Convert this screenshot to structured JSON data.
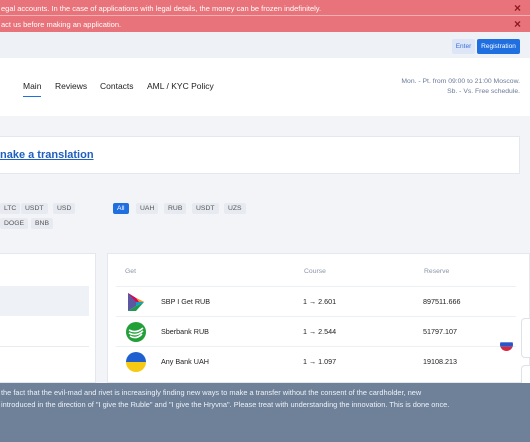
{
  "alerts": [
    {
      "text": "egal accounts. In the case of applications with legal details, the money can be frozen indefinitely.",
      "close": "×"
    },
    {
      "text": "act us before making an application.",
      "close": "×"
    }
  ],
  "topbar": {
    "enter_label": "Enter",
    "register_label": "Registration"
  },
  "nav": {
    "items": [
      {
        "label": "Main",
        "active": true
      },
      {
        "label": "Reviews",
        "active": false
      },
      {
        "label": "Contacts",
        "active": false
      },
      {
        "label": "AML / KYC Policy",
        "active": false
      }
    ],
    "schedule_line1": "Mon. - Pt. from 09:00 to 21:00 Moscow.",
    "schedule_line2": "Sb. - Vs. Free schedule."
  },
  "translate": {
    "link_text": "nake a translation"
  },
  "give_filters": [
    "LTC",
    "USDT",
    "USD",
    "DOGE",
    "BNB"
  ],
  "get_filters": [
    {
      "label": "All",
      "active": true
    },
    {
      "label": "UAH",
      "active": false
    },
    {
      "label": "RUB",
      "active": false
    },
    {
      "label": "USDT",
      "active": false
    },
    {
      "label": "UZS",
      "active": false
    }
  ],
  "table": {
    "headers": {
      "get": "Get",
      "course": "Course",
      "reserve": "Reserve"
    },
    "rows": [
      {
        "name": "SBP I Get RUB",
        "course": "1 → 2.601",
        "reserve": "897511.666",
        "icon": "sbp-icon"
      },
      {
        "name": "Sberbank RUB",
        "course": "1 → 2.544",
        "reserve": "51797.107",
        "icon": "sberbank-icon"
      },
      {
        "name": "Any Bank UAH",
        "course": "1 → 1.097",
        "reserve": "19108.213",
        "icon": "ukraine-flag-icon"
      }
    ]
  },
  "notice": {
    "line1": "the fact that the evil-mad and rivet is increasingly finding new ways to make a transfer without the consent of the cardholder, new",
    "line2": "introduced in the direction of \"I give the Ruble\" and \"I give the Hryvna\". Please treat with understanding the innovation. This is done once."
  },
  "colors": {
    "accent": "#1f6fe0",
    "alert": "#e8737a",
    "notice": "#6e8199"
  }
}
